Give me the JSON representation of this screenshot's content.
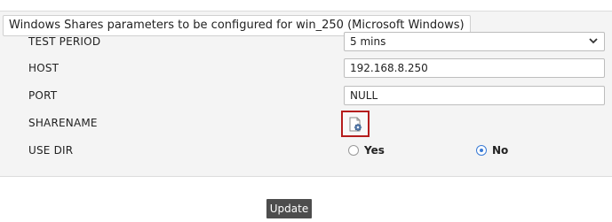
{
  "panel": {
    "title": "Windows Shares parameters to be configured for win_250 (Microsoft Windows)"
  },
  "fields": {
    "test_period": {
      "label": "TEST PERIOD",
      "value": "5 mins"
    },
    "host": {
      "label": "HOST",
      "value": "192.168.8.250"
    },
    "port": {
      "label": "PORT",
      "value": "NULL"
    },
    "sharename": {
      "label": "SHARENAME",
      "icon": "gear-document-icon"
    },
    "use_dir": {
      "label": "USE DIR",
      "options": [
        {
          "label": "Yes",
          "checked": false
        },
        {
          "label": "No",
          "checked": true
        }
      ]
    }
  },
  "actions": {
    "update_label": "Update"
  },
  "colors": {
    "highlight_border": "#b51c1c",
    "radio_selected": "#3a7bd5",
    "button_bg": "#4d4d4d"
  }
}
